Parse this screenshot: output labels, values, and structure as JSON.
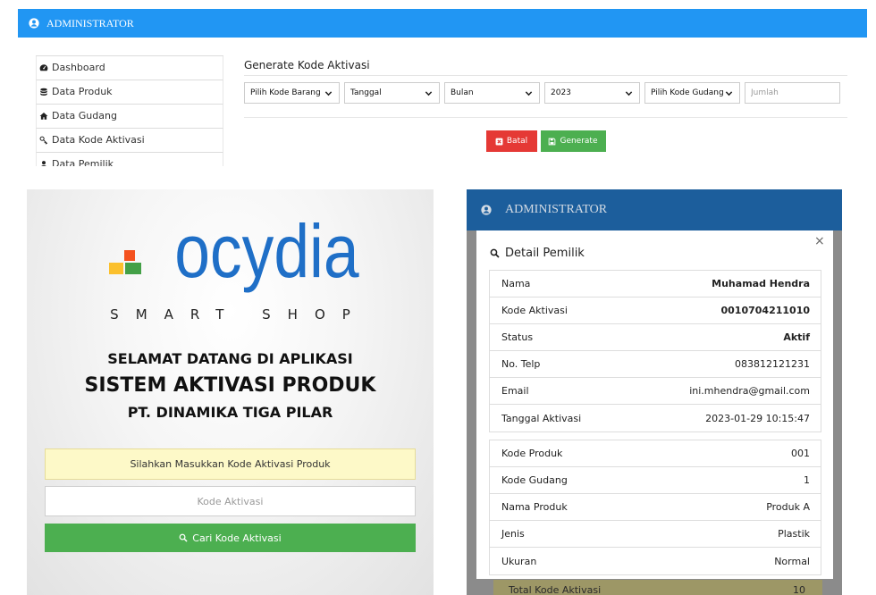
{
  "top_panel": {
    "header": {
      "title": "ADMINISTRATOR",
      "icon": "user-circle-icon"
    },
    "sidebar": {
      "items": [
        {
          "label": "Dashboard",
          "icon": "dashboard-icon"
        },
        {
          "label": "Data Produk",
          "icon": "database-icon"
        },
        {
          "label": "Data Gudang",
          "icon": "home-icon"
        },
        {
          "label": "Data Kode Aktivasi",
          "icon": "key-icon"
        },
        {
          "label": "Data Pemilik",
          "icon": "user-icon"
        }
      ]
    },
    "form": {
      "title": "Generate Kode Aktivasi",
      "selects": [
        {
          "value": "Pilih Kode Barang"
        },
        {
          "value": "Tanggal"
        },
        {
          "value": "Bulan"
        },
        {
          "value": "2023"
        },
        {
          "value": "Pilih Kode Gudang"
        }
      ],
      "jumlah_placeholder": "Jumlah",
      "cancel_label": "Batal",
      "cancel_icon": "close-square-icon",
      "generate_label": "Generate",
      "generate_icon": "save-icon"
    }
  },
  "login_panel": {
    "logo_text": "ocydia",
    "logo_tagline": "SMART SHOP",
    "welcome": "SELAMAT DATANG DI APLIKASI",
    "app_name": "SISTEM AKTIVASI PRODUK",
    "company": "PT. DINAMIKA TIGA PILAR",
    "notice": "Silahkan Masukkan Kode Aktivasi Produk",
    "code_placeholder": "Kode Aktivasi",
    "search_label": "Cari Kode Aktivasi",
    "search_icon": "search-icon"
  },
  "detail_panel": {
    "header_title": "ADMINISTRATOR",
    "modal": {
      "title": "Detail Pemilik",
      "close_symbol": "×",
      "owner_rows": [
        {
          "label": "Nama",
          "value": "Muhamad Hendra"
        },
        {
          "label": "Kode Aktivasi",
          "value": "0010704211010"
        },
        {
          "label": "Status",
          "value": "Aktif"
        },
        {
          "label": "No. Telp",
          "value": "083812121231"
        },
        {
          "label": "Email",
          "value": "ini.mhendra@gmail.com"
        },
        {
          "label": "Tanggal Aktivasi",
          "value": "2023-01-29 10:15:47"
        }
      ],
      "product_rows": [
        {
          "label": "Kode Produk",
          "value": "001"
        },
        {
          "label": "Kode Gudang",
          "value": "1"
        },
        {
          "label": "Nama Produk",
          "value": "Produk A"
        },
        {
          "label": "Jenis",
          "value": "Plastik"
        },
        {
          "label": "Ukuran",
          "value": "Normal"
        }
      ]
    },
    "background_row": {
      "label": "Total Kode Aktivasi",
      "value": "10"
    }
  },
  "colors": {
    "header_blue": "#2196f3",
    "header_blue_dimmed": "#1c5e9c",
    "logo_blue": "#1f6fc7",
    "danger_red": "#e53935",
    "success_green": "#4caf50",
    "notice_yellow": "#fdf9c8",
    "overlay_gray": "#8b8b8b",
    "dimmed_row": "#9d9766"
  }
}
